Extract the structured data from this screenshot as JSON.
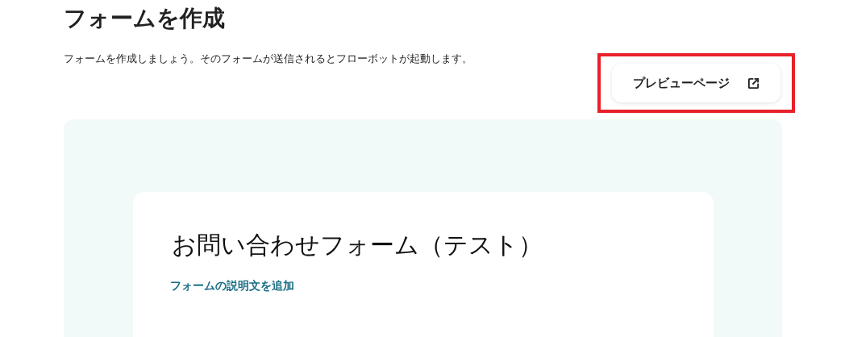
{
  "page": {
    "title": "フォームを作成",
    "description": "フォームを作成しましょう。そのフォームが送信されるとフローボットが起動します。"
  },
  "preview_button": {
    "label": "プレビューページ",
    "highlighted": true
  },
  "form": {
    "title": "お問い合わせフォーム（テスト）",
    "add_description_link": "フォームの説明文を追加"
  }
}
